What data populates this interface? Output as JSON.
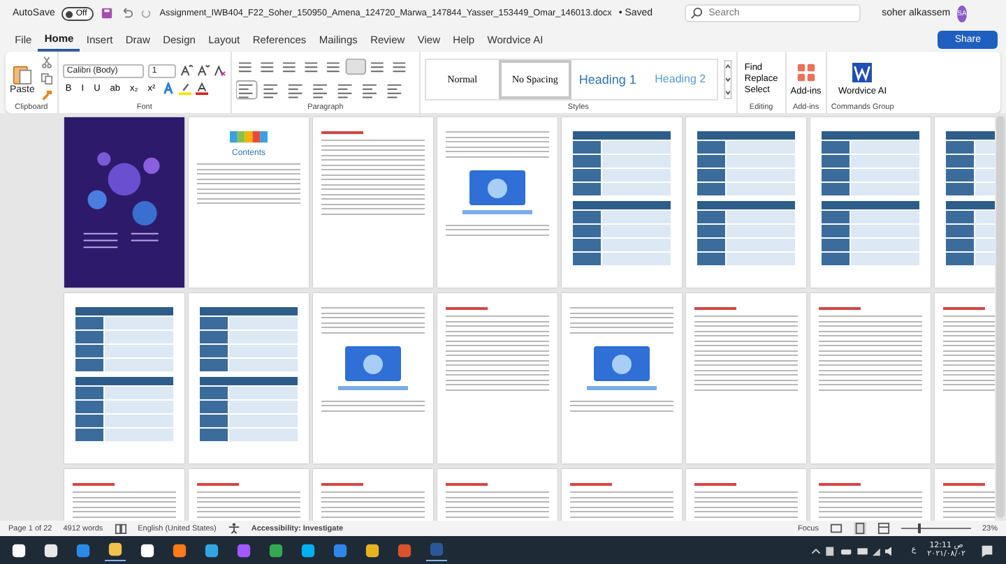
{
  "title_bar": {
    "autosave_label": "AutoSave",
    "autosave_toggle": {
      "label": "Off",
      "on": false
    },
    "document_name": "Assignment_IWB404_F22_Soher_150950_Amena_124720_Marwa_147844_Yasser_153449_Omar_146013.docx",
    "save_status": "• Saved",
    "search": {
      "placeholder": "Search"
    },
    "user_name": "soher alkassem",
    "user_initials": "SA"
  },
  "tabs": [
    {
      "label": "File",
      "selected": false
    },
    {
      "label": "Home",
      "selected": true
    },
    {
      "label": "Insert",
      "selected": false
    },
    {
      "label": "Draw",
      "selected": false
    },
    {
      "label": "Design",
      "selected": false
    },
    {
      "label": "Layout",
      "selected": false
    },
    {
      "label": "References",
      "selected": false
    },
    {
      "label": "Mailings",
      "selected": false
    },
    {
      "label": "Review",
      "selected": false
    },
    {
      "label": "View",
      "selected": false
    },
    {
      "label": "Help",
      "selected": false
    },
    {
      "label": "Wordvice AI",
      "selected": false
    }
  ],
  "share_button": "Share",
  "ribbon": {
    "clipboard": {
      "paste": "Paste",
      "label": "Clipboard"
    },
    "font": {
      "family": "Calibri (Body)",
      "size": "1",
      "buttons": [
        "B",
        "I",
        "U",
        "ab",
        "x₂",
        "x²"
      ],
      "label": "Font"
    },
    "paragraph": {
      "label": "Paragraph"
    },
    "styles": {
      "items": [
        {
          "label": "Normal",
          "kind": "normal",
          "selected": false
        },
        {
          "label": "No Spacing",
          "kind": "nospacing",
          "selected": true
        },
        {
          "label": "Heading 1",
          "kind": "heading1",
          "selected": false
        },
        {
          "label": "Heading 2",
          "kind": "heading2",
          "selected": false
        }
      ],
      "label": "Styles"
    },
    "editing": {
      "items": [
        "Find",
        "Replace",
        "Select"
      ],
      "label": "Editing"
    },
    "addins": {
      "button": "Add-ins",
      "label": "Add-ins"
    },
    "commands": {
      "button": "Wordvice AI",
      "label": "Commands Group"
    }
  },
  "pages": [
    {
      "kind": "cover"
    },
    {
      "kind": "toc",
      "title": "Contents"
    },
    {
      "kind": "text"
    },
    {
      "kind": "image"
    },
    {
      "kind": "table"
    },
    {
      "kind": "table"
    },
    {
      "kind": "table"
    },
    {
      "kind": "table"
    },
    {
      "kind": "table"
    },
    {
      "kind": "table"
    },
    {
      "kind": "image"
    },
    {
      "kind": "text"
    },
    {
      "kind": "image"
    },
    {
      "kind": "text"
    },
    {
      "kind": "text"
    },
    {
      "kind": "text"
    },
    {
      "kind": "text"
    },
    {
      "kind": "text"
    },
    {
      "kind": "text"
    },
    {
      "kind": "text"
    },
    {
      "kind": "text"
    },
    {
      "kind": "text"
    },
    {
      "kind": "text"
    },
    {
      "kind": "text"
    }
  ],
  "status_bar": {
    "page": "Page 1 of 22",
    "words": "4912 words",
    "language": "English (United States)",
    "accessibility": "Accessibility: Investigate",
    "focus": "Focus",
    "zoom": {
      "level": 0.25,
      "reading": "23%"
    }
  },
  "taskbar": {
    "language": "ع",
    "time": "12:11",
    "period": "ص",
    "date": "٢٠٢١/٠٨/٠٢"
  }
}
